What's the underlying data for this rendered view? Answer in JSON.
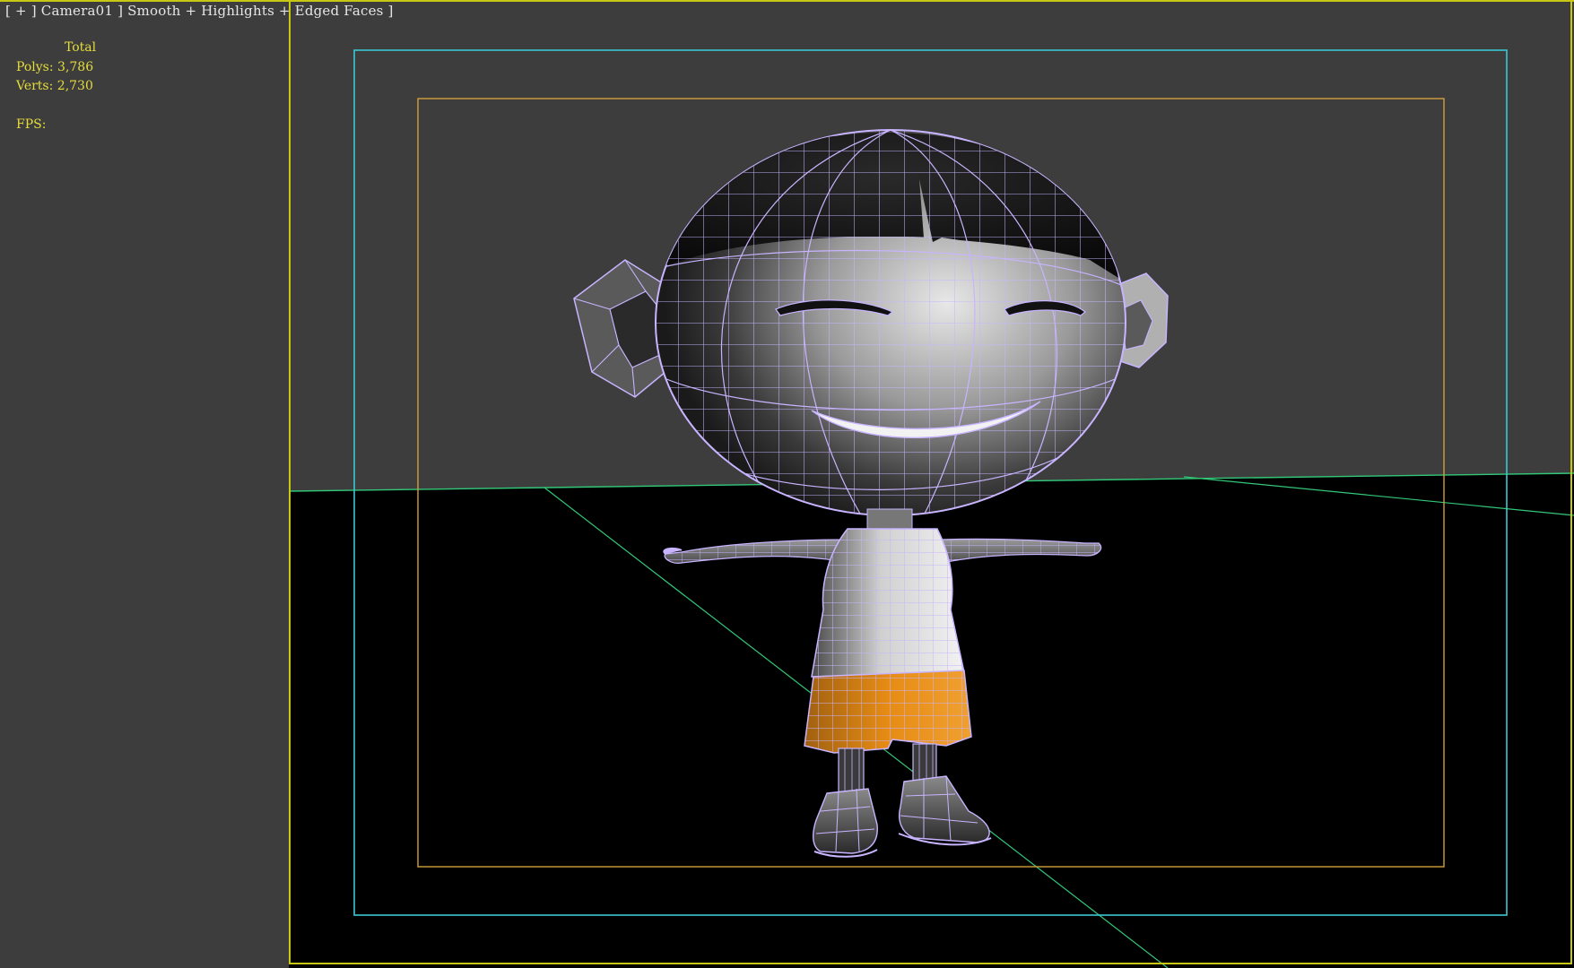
{
  "viewport": {
    "label_parts": [
      "[ + ] ",
      "Camera01",
      " ] ",
      "Smooth + Highlights + Edged Faces",
      " ]"
    ],
    "label": "[ + ] Camera01 ] Smooth + Highlights + Edged Faces ]",
    "view_name": "Camera01",
    "shading_mode": "Smooth + Highlights + Edged Faces"
  },
  "stats": {
    "header": "Total",
    "polys_label": "Polys:",
    "polys_value": "3,786",
    "verts_label": "Verts:",
    "verts_value": "2,730",
    "fps_label": "FPS:",
    "fps_value": ""
  },
  "colors": {
    "viewport_bg": "#3d3d3d",
    "ground": "#000000",
    "active_border": "#c8c814",
    "safe_frame_outer": "#3cc8d2",
    "safe_frame_inner": "#d2a03c",
    "horizon_line": "#32c878",
    "wireframe": "#c8b4ff",
    "stats_text": "#e6dc3c",
    "label_text": "#e6e6e6",
    "shorts": "#e68c14"
  },
  "scene": {
    "object": "cartoon-boy-character-model"
  }
}
